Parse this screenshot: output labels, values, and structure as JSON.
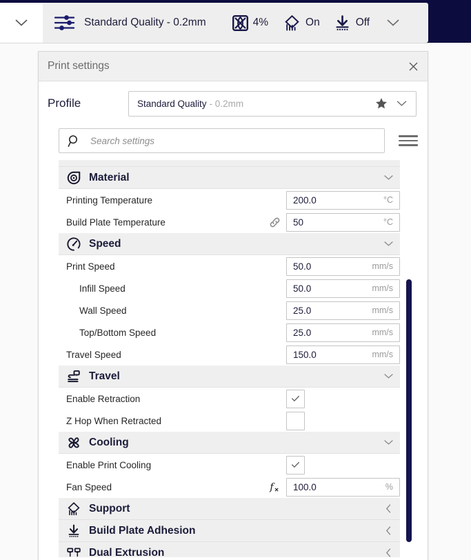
{
  "topbar": {
    "collapse_caret": "chevron-down",
    "profile_name": "Standard Quality - 0.2mm",
    "metrics": [
      {
        "icon": "infill-grid-icon",
        "value": "4%"
      },
      {
        "icon": "support-icon",
        "value": "On"
      },
      {
        "icon": "adhesion-icon",
        "value": "Off"
      }
    ],
    "expand_caret": "chevron-down"
  },
  "panel": {
    "title": "Print settings",
    "close_label": "×",
    "profile": {
      "label": "Profile",
      "value": "Standard Quality",
      "value_suffix": "- 0.2mm",
      "favorite_icon": "star-icon",
      "dropdown_icon": "chevron-down-icon"
    },
    "search": {
      "placeholder": "Search settings",
      "value": "",
      "icon": "search-icon",
      "menu_icon": "hamburger-icon"
    }
  },
  "settings": {
    "categories": [
      {
        "name": "Material",
        "icon": "material-spool-icon",
        "expanded": true,
        "chevron": "chevron-down-icon",
        "rows": [
          {
            "label": "Printing Temperature",
            "type": "value",
            "value": "200.0",
            "unit": "°C",
            "indent": false,
            "extra": ""
          },
          {
            "label": "Build Plate Temperature",
            "type": "value",
            "value": "50",
            "unit": "°C",
            "indent": false,
            "extra": "link-icon"
          }
        ]
      },
      {
        "name": "Speed",
        "icon": "speedometer-icon",
        "expanded": true,
        "chevron": "chevron-down-icon",
        "rows": [
          {
            "label": "Print Speed",
            "type": "value",
            "value": "50.0",
            "unit": "mm/s",
            "indent": false,
            "extra": ""
          },
          {
            "label": "Infill Speed",
            "type": "value",
            "value": "50.0",
            "unit": "mm/s",
            "indent": true,
            "extra": ""
          },
          {
            "label": "Wall Speed",
            "type": "value",
            "value": "25.0",
            "unit": "mm/s",
            "indent": true,
            "extra": ""
          },
          {
            "label": "Top/Bottom Speed",
            "type": "value",
            "value": "25.0",
            "unit": "mm/s",
            "indent": true,
            "extra": ""
          },
          {
            "label": "Travel Speed",
            "type": "value",
            "value": "150.0",
            "unit": "mm/s",
            "indent": false,
            "extra": ""
          }
        ]
      },
      {
        "name": "Travel",
        "icon": "travel-icon",
        "expanded": true,
        "chevron": "chevron-down-icon",
        "rows": [
          {
            "label": "Enable Retraction",
            "type": "checkbox",
            "checked": true,
            "indent": false,
            "extra": ""
          },
          {
            "label": "Z Hop When Retracted",
            "type": "checkbox",
            "checked": false,
            "indent": false,
            "extra": ""
          }
        ]
      },
      {
        "name": "Cooling",
        "icon": "fan-icon",
        "expanded": true,
        "chevron": "chevron-down-icon",
        "rows": [
          {
            "label": "Enable Print Cooling",
            "type": "checkbox",
            "checked": true,
            "indent": false,
            "extra": ""
          },
          {
            "label": "Fan Speed",
            "type": "value",
            "value": "100.0",
            "unit": "%",
            "indent": false,
            "extra": "function-icon"
          }
        ]
      },
      {
        "name": "Support",
        "icon": "support-icon",
        "expanded": false,
        "chevron": "chevron-left-icon",
        "rows": []
      },
      {
        "name": "Build Plate Adhesion",
        "icon": "adhesion-icon",
        "expanded": false,
        "chevron": "chevron-left-icon",
        "rows": []
      },
      {
        "name": "Dual Extrusion",
        "icon": "dual-extrusion-icon",
        "expanded": false,
        "chevron": "chevron-left-icon",
        "rows": []
      }
    ]
  },
  "colors": {
    "navy": "#0d0c3f",
    "accent_text": "#1b1b3a",
    "scrollbar": "#15144e",
    "category_bg": "#efefef",
    "panel_header_bg": "#f0f0f0"
  }
}
